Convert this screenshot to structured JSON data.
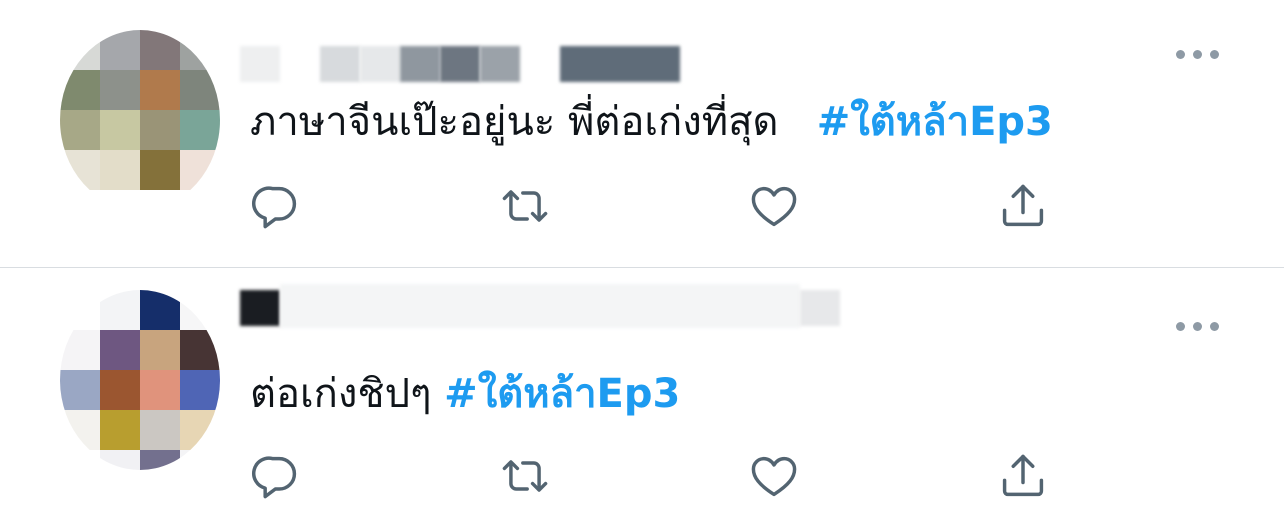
{
  "colors": {
    "text": "#0f1419",
    "hashtag": "#1d9bf0",
    "icon": "#536471",
    "divider": "#d9dde1"
  },
  "tweets": [
    {
      "text": "ภาษาจีนเป๊ะอยู่นะ พี่ต่อเก่งที่สุด",
      "hashtag": "#ใต้หล้าEp3",
      "more_icon": "more-horizontal-icon",
      "actions": [
        "reply-icon",
        "retweet-icon",
        "like-icon",
        "share-icon"
      ]
    },
    {
      "text": "ต่อเก่งชิปๆ",
      "hashtag": "#ใต้หล้าEp3",
      "more_icon": "more-horizontal-icon",
      "actions": [
        "reply-icon",
        "retweet-icon",
        "like-icon",
        "share-icon"
      ]
    }
  ]
}
